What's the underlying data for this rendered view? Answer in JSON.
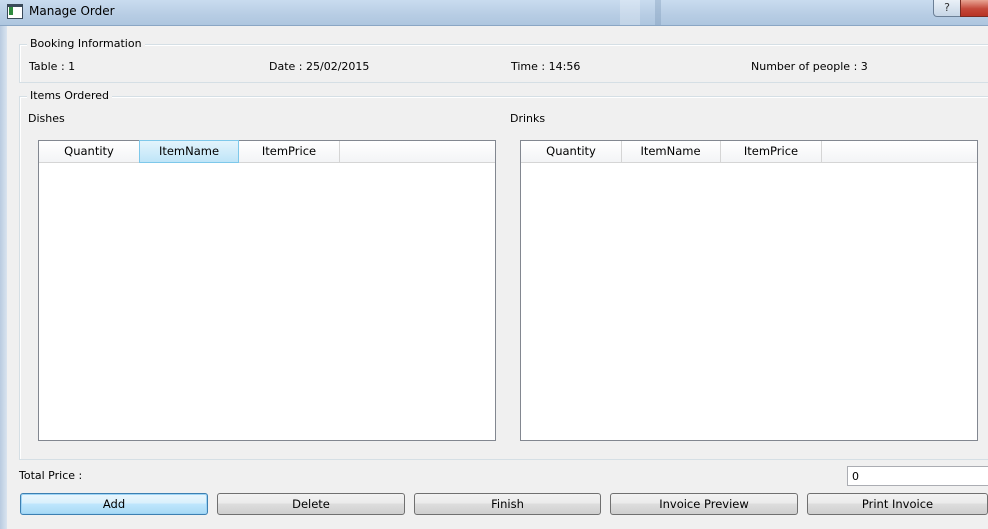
{
  "window": {
    "title": "Manage Order",
    "help_glyph": "?"
  },
  "booking": {
    "group_title": "Booking Information",
    "table": "Table : 1",
    "date": "Date : 25/02/2015",
    "time": "Time : 14:56",
    "people": "Number of people : 3"
  },
  "items": {
    "group_title": "Items Ordered",
    "dishes": {
      "label": "Dishes",
      "columns": [
        "Quantity",
        "ItemName",
        "ItemPrice"
      ],
      "selected_column": "ItemName",
      "rows": []
    },
    "drinks": {
      "label": "Drinks",
      "columns": [
        "Quantity",
        "ItemName",
        "ItemPrice"
      ],
      "rows": []
    }
  },
  "total": {
    "label": "Total Price :",
    "value": "0"
  },
  "buttons": {
    "add": "Add",
    "delete": "Delete",
    "finish": "Finish",
    "invoice_preview": "Invoice Preview",
    "print_invoice": "Print Invoice"
  },
  "icons": {
    "app": "app-window-icon",
    "help": "help-icon",
    "close": "close-icon"
  }
}
